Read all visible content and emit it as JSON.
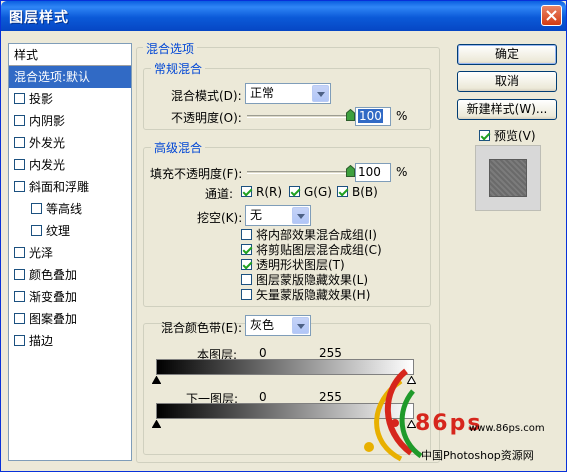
{
  "window": {
    "title": "图层样式"
  },
  "styles_list": {
    "header": "样式",
    "items": [
      {
        "label": "混合选项:默认",
        "selected": true,
        "checkbox": false,
        "checked": false,
        "indent": false
      },
      {
        "label": "投影",
        "selected": false,
        "checkbox": true,
        "checked": false,
        "indent": false
      },
      {
        "label": "内阴影",
        "selected": false,
        "checkbox": true,
        "checked": false,
        "indent": false
      },
      {
        "label": "外发光",
        "selected": false,
        "checkbox": true,
        "checked": false,
        "indent": false
      },
      {
        "label": "内发光",
        "selected": false,
        "checkbox": true,
        "checked": false,
        "indent": false
      },
      {
        "label": "斜面和浮雕",
        "selected": false,
        "checkbox": true,
        "checked": false,
        "indent": false
      },
      {
        "label": "等高线",
        "selected": false,
        "checkbox": true,
        "checked": false,
        "indent": true
      },
      {
        "label": "纹理",
        "selected": false,
        "checkbox": true,
        "checked": false,
        "indent": true
      },
      {
        "label": "光泽",
        "selected": false,
        "checkbox": true,
        "checked": false,
        "indent": false
      },
      {
        "label": "颜色叠加",
        "selected": false,
        "checkbox": true,
        "checked": false,
        "indent": false
      },
      {
        "label": "渐变叠加",
        "selected": false,
        "checkbox": true,
        "checked": false,
        "indent": false
      },
      {
        "label": "图案叠加",
        "selected": false,
        "checkbox": true,
        "checked": false,
        "indent": false
      },
      {
        "label": "描边",
        "selected": false,
        "checkbox": true,
        "checked": false,
        "indent": false
      }
    ]
  },
  "blend_options": {
    "legend": "混合选项",
    "general": {
      "legend": "常规混合",
      "blend_mode_label": "混合模式(D):",
      "blend_mode_value": "正常",
      "opacity_label": "不透明度(O):",
      "opacity_value": "100",
      "opacity_fraction": 1.0,
      "percent": "%"
    },
    "advanced": {
      "legend": "高级混合",
      "fill_opacity_label": "填充不透明度(F):",
      "fill_opacity_value": "100",
      "fill_fraction": 1.0,
      "percent": "%",
      "channels_label": "通道:",
      "channel_r": "R(R)",
      "channel_g": "G(G)",
      "channel_b": "B(B)",
      "knockout_label": "挖空(K):",
      "knockout_value": "无",
      "options": [
        {
          "label": "将内部效果混合成组(I)",
          "checked": false
        },
        {
          "label": "将剪贴图层混合成组(C)",
          "checked": true
        },
        {
          "label": "透明形状图层(T)",
          "checked": true
        },
        {
          "label": "图层蒙版隐藏效果(L)",
          "checked": false
        },
        {
          "label": "矢量蒙版隐藏效果(H)",
          "checked": false
        }
      ]
    },
    "blend_if": {
      "label": "混合颜色带(E):",
      "value": "灰色",
      "this_layer_label": "本图层:",
      "this_layer_min": "0",
      "this_layer_max": "255",
      "below_layer_label": "下一图层:",
      "below_layer_min": "0",
      "below_layer_max": "255"
    }
  },
  "buttons": {
    "ok": "确定",
    "cancel": "取消",
    "new_style": "新建样式(W)...",
    "preview_label": "预览(V)",
    "preview_checked": true
  },
  "watermark": {
    "site": "www.86ps.com",
    "brand": "86ps",
    "caption": "中国Photoshop资源网"
  }
}
